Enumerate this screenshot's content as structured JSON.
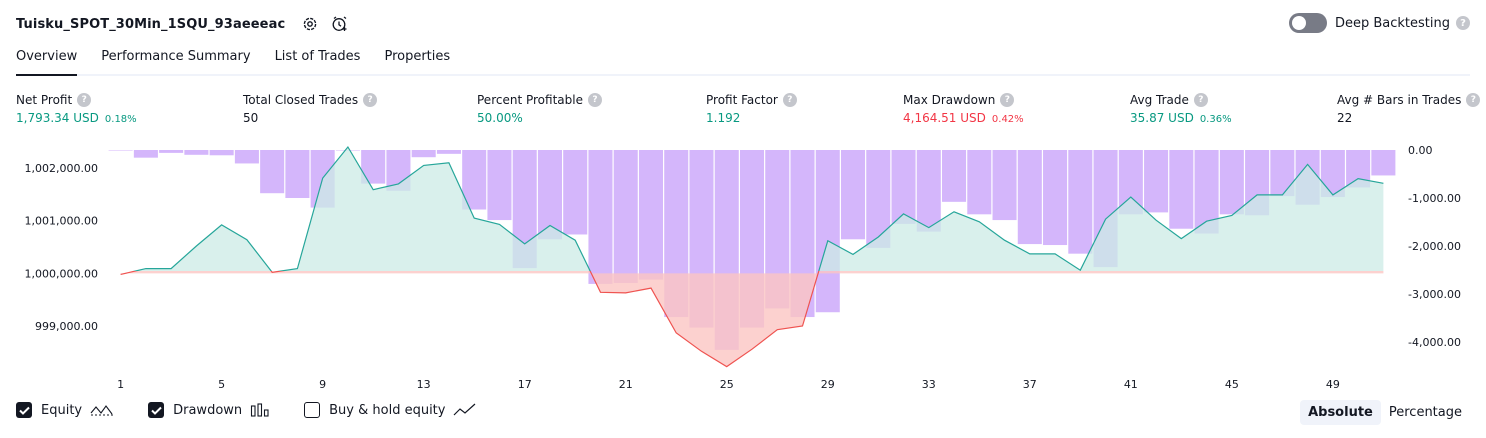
{
  "header": {
    "title": "Tuisku_SPOT_30Min_1SQU_93aeeeac",
    "settings_icon": "gear-icon",
    "alert_icon": "add-alert-icon",
    "deep_backtesting_label": "Deep Backtesting",
    "deep_backtesting_on": false,
    "help_glyph": "?"
  },
  "tabs": [
    {
      "label": "Overview",
      "active": true
    },
    {
      "label": "Performance Summary",
      "active": false
    },
    {
      "label": "List of Trades",
      "active": false
    },
    {
      "label": "Properties",
      "active": false
    }
  ],
  "metrics": [
    {
      "label": "Net Profit",
      "value": "1,793.34 USD",
      "pct": "0.18%",
      "color": "#089981"
    },
    {
      "label": "Total Closed Trades",
      "value": "50",
      "pct": "",
      "color": "#131722"
    },
    {
      "label": "Percent Profitable",
      "value": "50.00%",
      "pct": "",
      "color": "#089981"
    },
    {
      "label": "Profit Factor",
      "value": "1.192",
      "pct": "",
      "color": "#089981"
    },
    {
      "label": "Max Drawdown",
      "value": "4,164.51 USD",
      "pct": "0.42%",
      "color": "#f23645"
    },
    {
      "label": "Avg Trade",
      "value": "35.87 USD",
      "pct": "0.36%",
      "color": "#089981"
    },
    {
      "label": "Avg # Bars in Trades",
      "value": "22",
      "pct": "",
      "color": "#131722"
    }
  ],
  "chart_data": {
    "type": "line",
    "x": [
      1,
      2,
      3,
      4,
      5,
      6,
      7,
      8,
      9,
      10,
      11,
      12,
      13,
      14,
      15,
      16,
      17,
      18,
      19,
      20,
      21,
      22,
      23,
      24,
      25,
      26,
      27,
      28,
      29,
      30,
      31,
      32,
      33,
      34,
      35,
      36,
      37,
      38,
      39,
      40,
      41,
      42,
      43,
      44,
      45,
      46,
      47,
      48,
      49,
      50,
      51
    ],
    "x_tick_labels": [
      "1",
      "5",
      "9",
      "13",
      "17",
      "21",
      "25",
      "29",
      "33",
      "37",
      "41",
      "45",
      "49"
    ],
    "left_axis": {
      "tick_labels": [
        "1,002,000.00",
        "1,001,000.00",
        "1,000,000.00",
        "999,000.00"
      ],
      "ticks": [
        1002000,
        1001000,
        1000000,
        999000
      ],
      "range": [
        998260,
        1002400
      ]
    },
    "right_axis": {
      "tick_labels": [
        "0.00",
        "-1,000.00",
        "-2,000.00",
        "-3,000.00",
        "-4,000.00"
      ],
      "ticks": [
        0,
        -1000,
        -2000,
        -3000,
        -4000
      ],
      "range": [
        -4500,
        30
      ]
    },
    "baseline": 1000000,
    "series": [
      {
        "name": "Equity",
        "kind": "line",
        "values": [
          999980,
          1000090,
          1000090,
          1000520,
          1000920,
          1000640,
          1000020,
          1000090,
          1001810,
          1002400,
          1001590,
          1001700,
          1002050,
          1002100,
          1001050,
          1000930,
          1000560,
          1000910,
          1000630,
          999640,
          999630,
          999720,
          998870,
          998520,
          998230,
          998560,
          998930,
          999000,
          1000620,
          1000360,
          1000690,
          1001130,
          1000870,
          1001170,
          1000980,
          1000630,
          1000370,
          1000370,
          1000060,
          1001030,
          1001450,
          1001010,
          1000660,
          1000990,
          1001100,
          1001490,
          1001490,
          1002070,
          1001490,
          1001800,
          1001710
        ]
      },
      {
        "name": "Drawdown",
        "kind": "bar",
        "values": [
          -10,
          -160,
          -60,
          -100,
          -110,
          -280,
          -900,
          -1000,
          -1200,
          0,
          -700,
          -850,
          -150,
          -80,
          -1240,
          -1460,
          -2460,
          -1860,
          -1760,
          -2790,
          -2770,
          -2700,
          -3480,
          -3700,
          -4164,
          -3700,
          -3300,
          -3480,
          -3380,
          -1860,
          -2040,
          -1540,
          -1700,
          -1080,
          -1340,
          -1460,
          -1960,
          -1980,
          -2160,
          -2440,
          -1340,
          -1300,
          -1640,
          -1740,
          -1340,
          -1360,
          -960,
          -1140,
          -980,
          -780,
          -530
        ]
      }
    ],
    "colors": {
      "equity_line": "#26a69a",
      "equity_fill": "#ccebe6",
      "equity_line_below": "#ef5350",
      "equity_fill_below": "#fbc5c3",
      "drawdown": "#d4b6fb",
      "grid": "#f0f3fa"
    },
    "grid": false
  },
  "legend": [
    {
      "label": "Equity",
      "checked": true,
      "icon": "equity-line-icon"
    },
    {
      "label": "Drawdown",
      "checked": true,
      "icon": "drawdown-bars-icon"
    },
    {
      "label": "Buy & hold equity",
      "checked": false,
      "icon": "buy-hold-line-icon"
    }
  ],
  "mode": {
    "absolute": "Absolute",
    "percentage": "Percentage",
    "selected": "Absolute"
  }
}
